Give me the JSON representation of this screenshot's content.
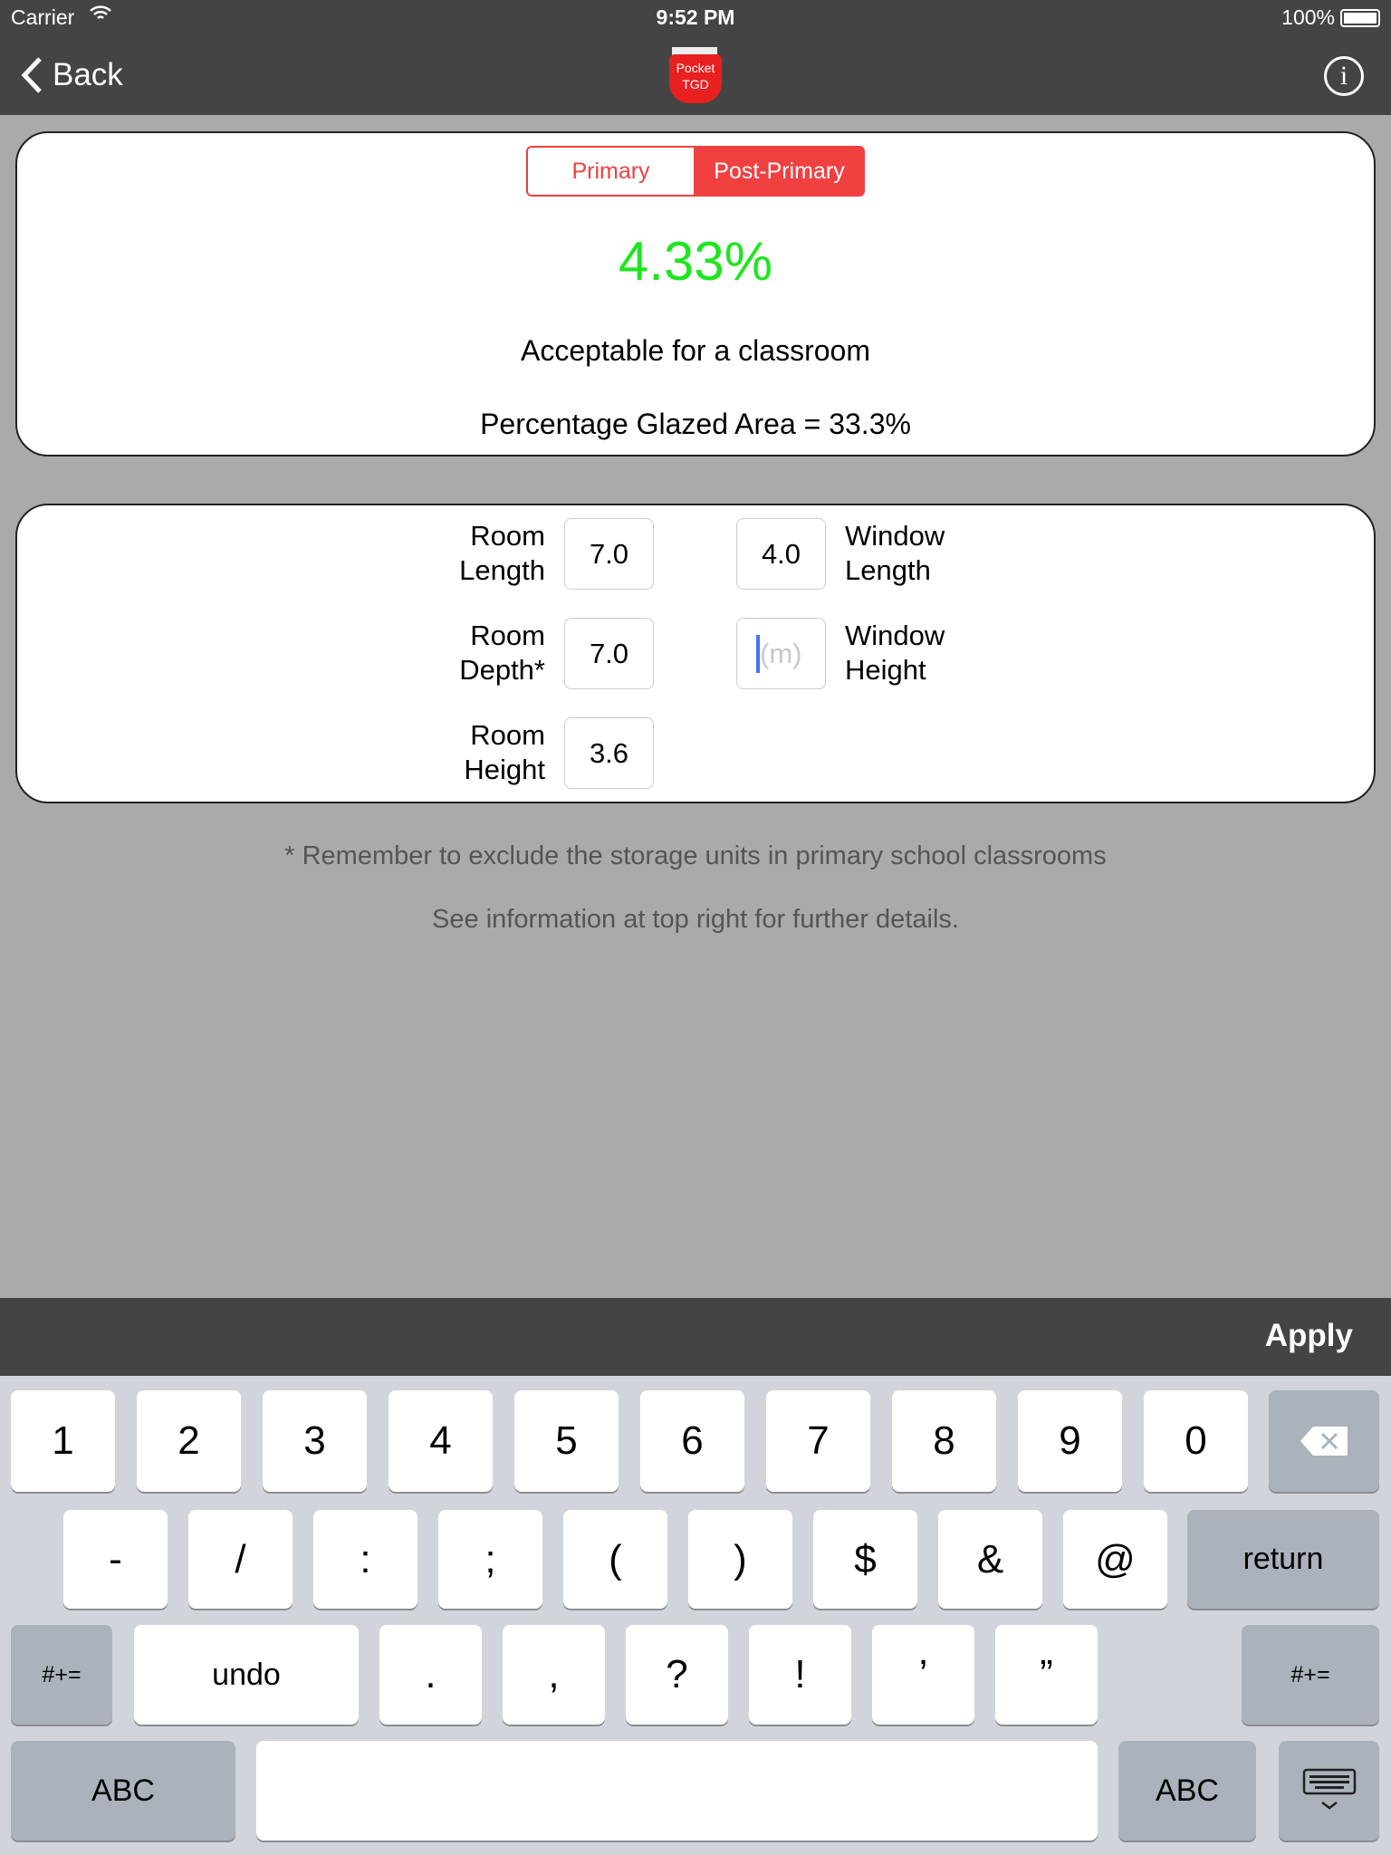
{
  "status_bar": {
    "carrier": "Carrier",
    "time": "9:52 PM",
    "battery": "100%"
  },
  "nav": {
    "back_label": "Back",
    "logo_text": "Pocket TGD",
    "info_icon": "info-icon"
  },
  "result_card": {
    "segments": [
      {
        "label": "Primary",
        "selected": false
      },
      {
        "label": "Post-Primary",
        "selected": true
      }
    ],
    "percentage": "4.33%",
    "percentage_color": "#1ee61e",
    "verdict": "Acceptable for a classroom",
    "glazed_area": "Percentage Glazed Area = 33.3%"
  },
  "inputs": {
    "room_length": {
      "label1": "Room",
      "label2": "Length",
      "value": "7.0"
    },
    "room_depth": {
      "label1": "Room",
      "label2": "Depth*",
      "value": "7.0"
    },
    "room_height": {
      "label1": "Room",
      "label2": "Height",
      "value": "3.6"
    },
    "window_length": {
      "label1": "Window",
      "label2": "Length",
      "value": "4.0"
    },
    "window_height": {
      "label1": "Window",
      "label2": "Height",
      "value": "",
      "placeholder": "(m)"
    }
  },
  "notes": [
    "* Remember to exclude the storage units in primary school classrooms",
    "See information at top right for further details."
  ],
  "toolbar": {
    "apply_label": "Apply"
  },
  "keyboard": {
    "row1": [
      "1",
      "2",
      "3",
      "4",
      "5",
      "6",
      "7",
      "8",
      "9",
      "0"
    ],
    "row2": [
      "-",
      "/",
      ":",
      ";",
      "(",
      ")",
      "$",
      "&",
      "@"
    ],
    "return": "return",
    "row3_left": "#+=",
    "undo": "undo",
    "row3": [
      ".",
      ",",
      "?",
      "!",
      "’",
      "”"
    ],
    "row3_right": "#+=",
    "abc_left": "ABC",
    "abc_right": "ABC"
  },
  "accent_color": "#f04040"
}
